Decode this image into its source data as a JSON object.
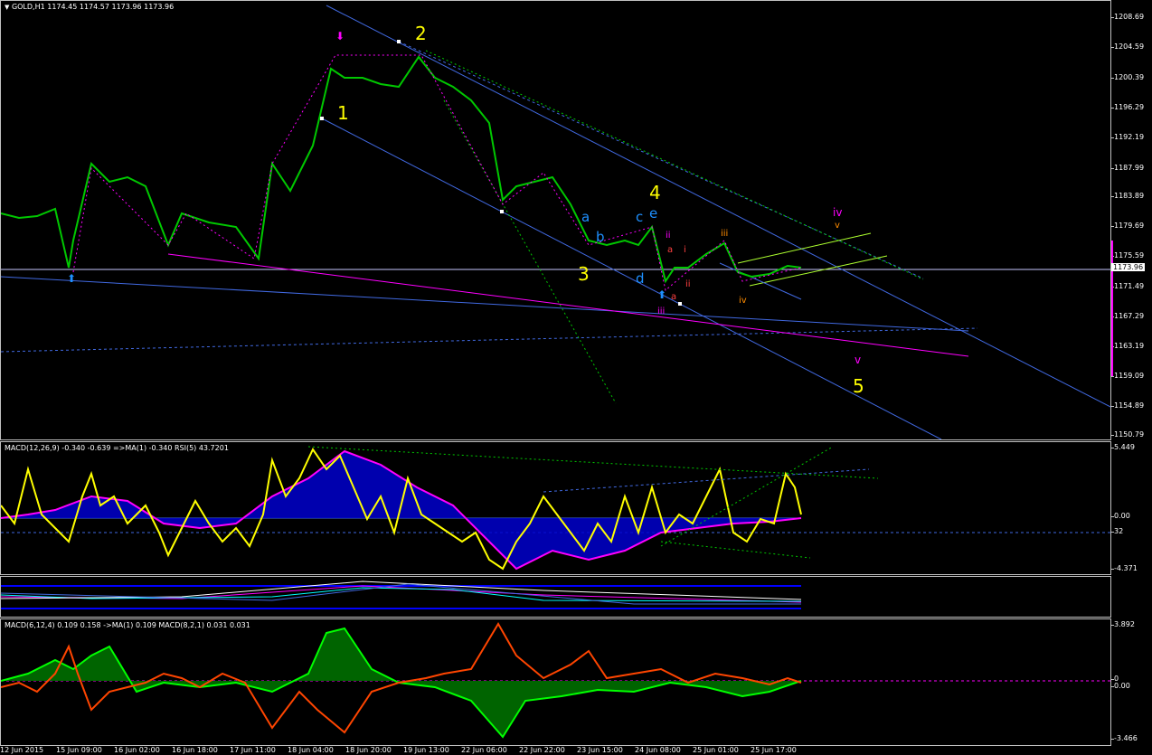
{
  "main": {
    "header": "GOLD,H1  1174.45 1174.57 1173.96 1173.96",
    "price_ticks": [
      "1208.69",
      "1204.59",
      "1200.39",
      "1196.29",
      "1192.19",
      "1187.99",
      "1183.89",
      "1179.69",
      "1175.59",
      "1171.49",
      "1167.29",
      "1163.19",
      "1159.09",
      "1154.89",
      "1150.79"
    ],
    "current_price": "1173.96",
    "wave_labels": {
      "w1": "1",
      "w2": "2",
      "w3": "3",
      "w4": "4",
      "w5": "5",
      "a": "a",
      "b": "b",
      "c": "c",
      "d": "d",
      "e": "e",
      "sub_i": "i",
      "sub_ii": "ii",
      "sub_iii": "iii",
      "sub_iv": "iv",
      "sub_v": "v",
      "iii_mag": "iii",
      "iv_mag": "iv",
      "v_mag": "v",
      "v_org": "v",
      "ii_low": "ii",
      "a_red": "a",
      "a_red2": "a",
      "iii_org": "iii",
      "iv_org": "iv"
    }
  },
  "macd_pane": {
    "header": "MACD(12,26,9) -0.340 -0.639  =>MA(1) -0.340  RSI(5) 43.7201",
    "ticks": [
      "5.449",
      "0.00",
      "32",
      "-4.371"
    ]
  },
  "mid_pane": {
    "ticks": []
  },
  "macd2_pane": {
    "header": "MACD(6,12,4) 0.109 0.158  ->MA(1) 0.109  MACD(8,2,1) 0.031 0.031",
    "ticks": [
      "3.892",
      "0",
      "0.00",
      "-3.466"
    ]
  },
  "time_axis": [
    "12 Jun 2015",
    "15 Jun 09:00",
    "16 Jun 02:00",
    "16 Jun 18:00",
    "17 Jun 11:00",
    "18 Jun 04:00",
    "18 Jun 20:00",
    "19 Jun 13:00",
    "22 Jun 06:00",
    "22 Jun 22:00",
    "23 Jun 15:00",
    "24 Jun 08:00",
    "25 Jun 01:00",
    "25 Jun 17:00"
  ],
  "colors": {
    "candle": "#00c800",
    "trend": "#4169e1",
    "wave": "#ffff00",
    "macd_line": "#ffff00",
    "signal": "#ff00ff",
    "hist": "#0000ff",
    "osc_green": "#00c800",
    "osc_red": "#ff4500"
  }
}
